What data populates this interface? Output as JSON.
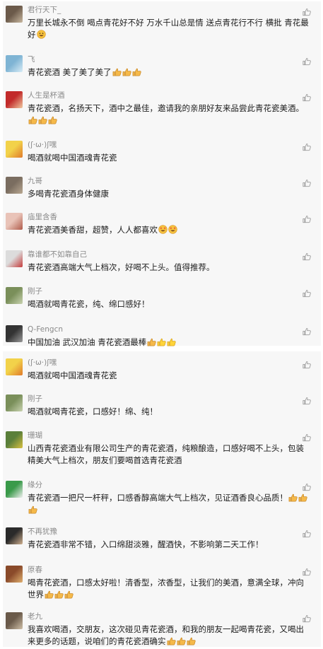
{
  "comments_top": [
    {
      "name": "君行天下_",
      "text": "万里长城永不倒 喝点青花好不好 万水千山总是情 送点青花行不行 横批 青花最好",
      "emoji": [
        "grin-sweat"
      ]
    },
    {
      "name": "飞",
      "text": "青花瓷酒 美了美了美了",
      "emoji": [
        "thumbs-up",
        "thumbs-up",
        "thumbs-up"
      ]
    },
    {
      "name": "人生是杯酒",
      "text": "青花瓷酒，名扬天下，酒中之最佳，邀请我的亲朋好友来品尝此青花瓷美酒。",
      "emoji": [
        "thumbs-up",
        "thumbs-up",
        "thumbs-up"
      ]
    },
    {
      "name": "(ʃ·ω·)ʃ嘿",
      "text": "喝酒就喝中国酒魂青花瓷",
      "emoji": []
    },
    {
      "name": "九哥",
      "text": "多喝青花瓷酒身体健康",
      "emoji": []
    },
    {
      "name": "庙里含香",
      "text": "青花瓷酒美香甜，超赞，人人都喜欢",
      "emoji": [
        "heart-eyes",
        "heart-eyes"
      ]
    },
    {
      "name": "靠谁都不如靠自己",
      "text": "青花瓷酒高端大气上档次，好喝不上头。值得推荐。",
      "emoji": []
    },
    {
      "name": "刚子",
      "text": "喝酒就喝青花瓷，纯、绵口感好！",
      "emoji": []
    },
    {
      "name": "Q-Fengcn",
      "text": "中国加油 武汉加油 青花瓷酒最棒",
      "emoji": [
        "thumbs-up",
        "thumbs-up-yellow",
        "thumbs-up-yellow"
      ]
    }
  ],
  "comments_bottom": [
    {
      "name": "(ʃ·ω·)ʃ嘿",
      "text": "喝酒就喝中国酒魂青花瓷",
      "emoji": []
    },
    {
      "name": "刚子",
      "text": "喝酒就喝青花瓷，口感好！绵、纯！",
      "emoji": []
    },
    {
      "name": "珊瑚",
      "text": "山西青花瓷酒业有限公司生产的青花瓷酒，纯粮酿造，口感好喝不上头，包装精美大气上档次，朋友们要喝首选青花瓷酒",
      "emoji": []
    },
    {
      "name": "缘分",
      "text": "青花瓷酒一把尺一杆秤，口感香醇高端大气上档次，见证酒香良心品质！",
      "emoji": [
        "thumbs-up",
        "thumbs-up",
        "thumbs-up"
      ]
    },
    {
      "name": "不再犹豫",
      "text": "青花瓷酒非常不错，入口绵甜淡雅，醒酒快，不影响第二天工作！",
      "emoji": []
    },
    {
      "name": "原春",
      "text": "喝青花瓷酒，口感太好啦！清香型，浓香型，让我们的美酒，意满全球，冲向世界",
      "emoji": [
        "thumbs-up",
        "thumbs-up",
        "thumbs-up"
      ]
    },
    {
      "name": "老九",
      "text": "我喜欢喝酒，交朋友，这次碰见青花瓷酒，和我的朋友一起喝青花瓷，又喝出来更多的话题，说咱们的青花瓷酒确实",
      "emoji": [
        "thumbs-up",
        "thumbs-up",
        "thumbs-up"
      ]
    }
  ],
  "colors": {
    "accent": "#f5a623",
    "name": "#8a8a8a",
    "text": "#1c1c1c",
    "like": "#9a9a9a"
  },
  "icons": {
    "like": "thumbs-up-outline-icon"
  }
}
